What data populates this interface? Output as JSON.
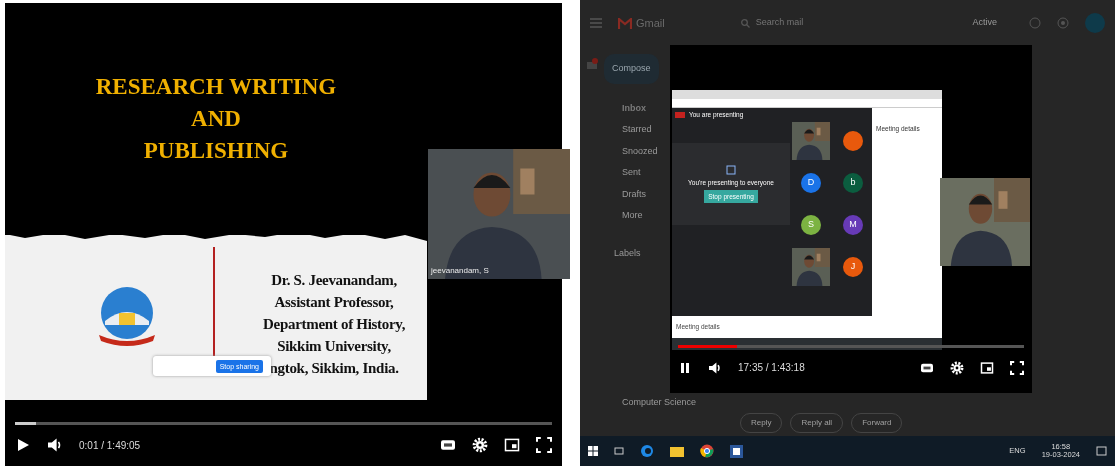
{
  "left_player": {
    "slide": {
      "title_lines": [
        "RESEARCH WRITING",
        "AND",
        "PUBLISHING"
      ],
      "speaker_lines": [
        "Dr. S. Jeevanandam,",
        "Assistant Professor,",
        "Department of History,",
        "Sikkim University,",
        "ngtok, Sikkim, India."
      ]
    },
    "webcam": {
      "name": "jeevanandam, S"
    },
    "share_bar": {
      "button": "Stop sharing"
    },
    "controls": {
      "playing": false,
      "level": 0.04,
      "time": "0:01 / 1:49:05"
    }
  },
  "right_screen": {
    "gmail": {
      "logo": "Gmail",
      "search": {
        "placeholder": "Search mail"
      },
      "status": "Active",
      "compose": "Compose",
      "nav": [
        {
          "label": "Inbox",
          "selected": true
        },
        {
          "label": "Starred",
          "selected": false
        },
        {
          "label": "Snoozed",
          "selected": false
        },
        {
          "label": "Sent",
          "selected": false
        },
        {
          "label": "Drafts",
          "selected": false
        },
        {
          "label": "More",
          "selected": false
        }
      ],
      "labels_heading": "Labels",
      "label_items": [
        "Computer Science"
      ],
      "actions": [
        "Reply",
        "Reply all",
        "Forward"
      ]
    },
    "video": {
      "meet": {
        "banner": "You are presenting",
        "message": "You're presenting to everyone",
        "stop_button": "Stop presenting",
        "panel_title": "Meeting details",
        "bottom_label": "Meeting details",
        "tiles": [
          {
            "kind": "video"
          },
          {
            "kind": "avatar",
            "color": "#e8590c"
          },
          {
            "kind": "avatar",
            "letter": "D",
            "color": "#1a73e8"
          },
          {
            "kind": "avatar",
            "letter": "b",
            "color": "#0b5d3f"
          },
          {
            "kind": "avatar",
            "letter": "S",
            "color": "#7cb342"
          },
          {
            "kind": "avatar",
            "letter": "M",
            "color": "#673ab7"
          },
          {
            "kind": "video"
          },
          {
            "kind": "avatar",
            "letter": "J",
            "color": "#e8590c"
          }
        ]
      },
      "controls": {
        "playing": true,
        "level": 0.17,
        "time": "17:35 / 1:43:18"
      }
    },
    "taskbar": {
      "language": "ENG",
      "time": "16:58",
      "date": "19-03-2024"
    }
  }
}
